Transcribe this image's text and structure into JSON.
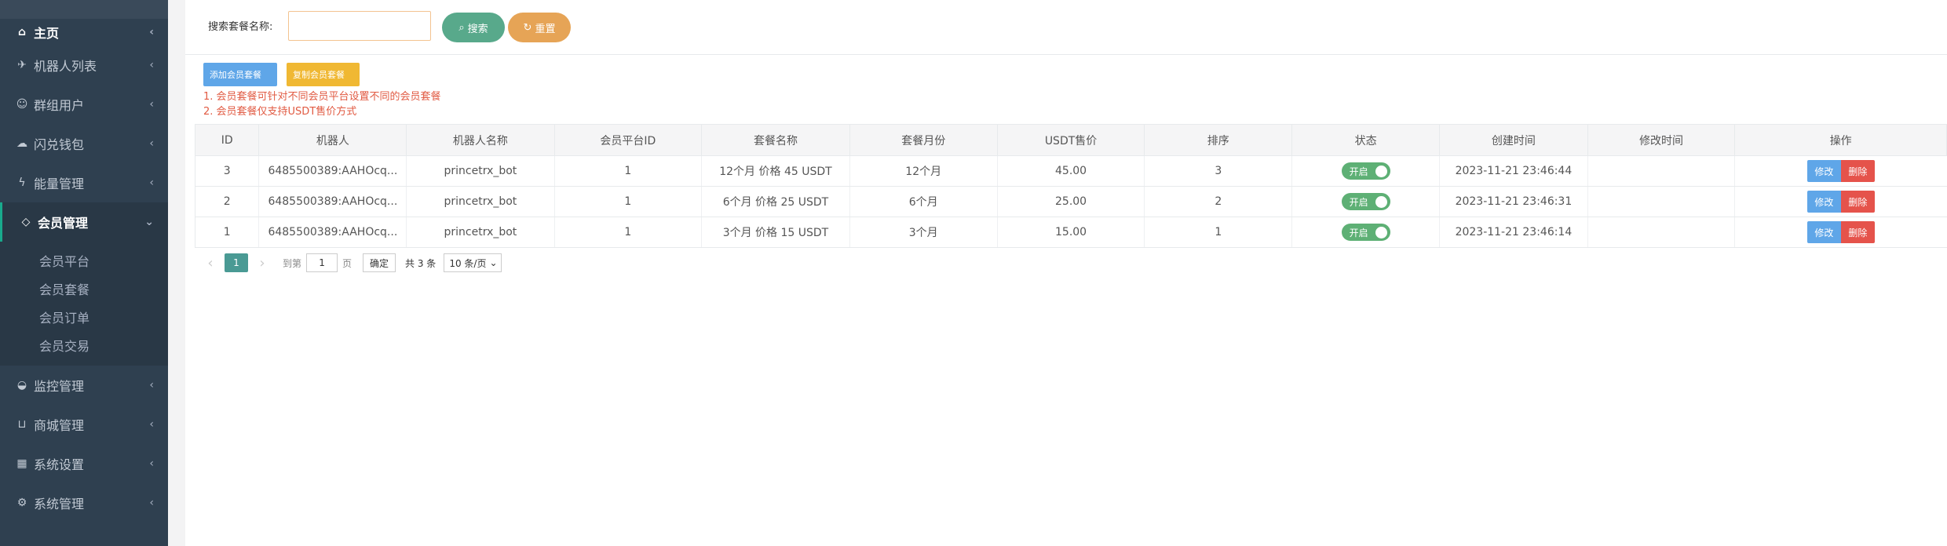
{
  "sidebar": {
    "items": [
      {
        "icon": "home-icon",
        "glyph": "⌂",
        "label": "主页"
      },
      {
        "icon": "plane-icon",
        "glyph": "✈",
        "label": "机器人列表"
      },
      {
        "icon": "users-icon",
        "glyph": "☺",
        "label": "群组用户"
      },
      {
        "icon": "cloud-icon",
        "glyph": "☁",
        "label": "闪兑钱包"
      },
      {
        "icon": "bolt-icon",
        "glyph": "ϟ",
        "label": "能量管理"
      },
      {
        "icon": "diamond-icon",
        "glyph": "◇",
        "label": "会员管理"
      },
      {
        "icon": "monitor-icon",
        "glyph": "◒",
        "label": "监控管理"
      },
      {
        "icon": "cart-icon",
        "glyph": "⊔",
        "label": "商城管理"
      },
      {
        "icon": "windows-icon",
        "glyph": "▦",
        "label": "系统设置"
      },
      {
        "icon": "gear-icon",
        "glyph": "⚙",
        "label": "系统管理"
      }
    ],
    "member_sub": [
      "会员平台",
      "会员套餐",
      "会员订单",
      "会员交易"
    ]
  },
  "search": {
    "label": "搜索套餐名称:",
    "value": "",
    "search_button": "搜索",
    "reset_button": "重置"
  },
  "toolbar": {
    "add_label": "添加会员套餐",
    "copy_label": "复制会员套餐"
  },
  "notes": [
    "1. 会员套餐可针对不同会员平台设置不同的会员套餐",
    "2. 会员套餐仅支持USDT售价方式"
  ],
  "table": {
    "columns": [
      "ID",
      "机器人",
      "机器人名称",
      "会员平台ID",
      "套餐名称",
      "套餐月份",
      "USDT售价",
      "排序",
      "状态",
      "创建时间",
      "修改时间",
      "操作"
    ],
    "rows": [
      {
        "id": "3",
        "bot": "6485500389:AAHOcq...",
        "bot_name": "princetrx_bot",
        "platform_id": "1",
        "package_name": "12个月 价格 45 USDT",
        "months": "12个月",
        "price": "45.00",
        "sort": "3",
        "status": "开启",
        "created": "2023-11-21 23:46:44",
        "modified": ""
      },
      {
        "id": "2",
        "bot": "6485500389:AAHOcq...",
        "bot_name": "princetrx_bot",
        "platform_id": "1",
        "package_name": "6个月 价格 25 USDT",
        "months": "6个月",
        "price": "25.00",
        "sort": "2",
        "status": "开启",
        "created": "2023-11-21 23:46:31",
        "modified": ""
      },
      {
        "id": "1",
        "bot": "6485500389:AAHOcq...",
        "bot_name": "princetrx_bot",
        "platform_id": "1",
        "package_name": "3个月 价格 15 USDT",
        "months": "3个月",
        "price": "15.00",
        "sort": "1",
        "status": "开启",
        "created": "2023-11-21 23:46:14",
        "modified": ""
      }
    ],
    "edit_label": "修改",
    "delete_label": "删除"
  },
  "pagination": {
    "current_page": "1",
    "goto_label": "到第",
    "page_input": "1",
    "page_unit": "页",
    "confirm_label": "确定",
    "total_label": "共 3 条",
    "page_size": "10 条/页"
  },
  "colors": {
    "sidebar_bg": "#2f4050",
    "search_green": "#58a98b",
    "reset_orange": "#e6a456",
    "add_blue": "#5fa6e8",
    "copy_yellow": "#f0b833",
    "note_red": "#e15a42",
    "toggle_green": "#5eb075",
    "delete_red": "#e5534b",
    "pager_teal": "#4a9a94"
  }
}
